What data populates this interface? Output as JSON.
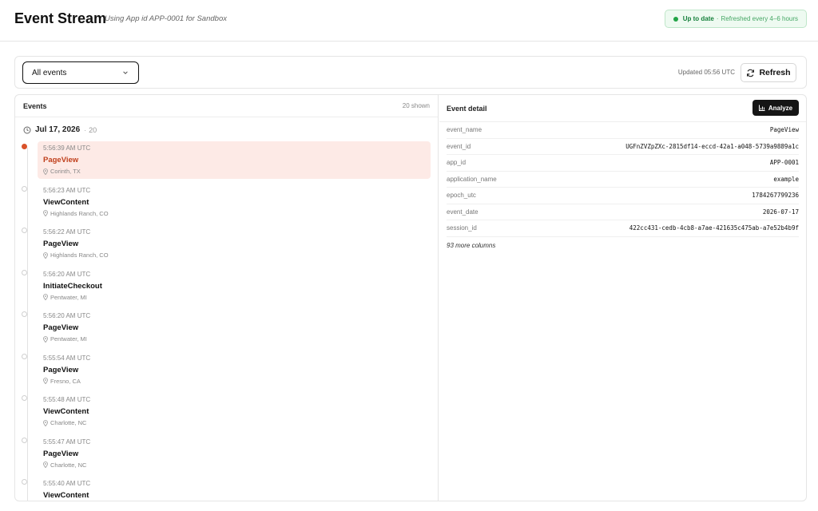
{
  "header": {
    "title": "Event Stream",
    "subtitle": "Using App id APP-0001 for Sandbox",
    "status": {
      "main": "Up to date",
      "separator": "·",
      "sub": "Refreshed every 4–6 hours",
      "color": "#22a447"
    }
  },
  "toolbar": {
    "filter_value": "All events",
    "updated_text": "Updated 05:56 UTC",
    "refresh_label": "Refresh"
  },
  "events_panel": {
    "title": "Events",
    "count_text": "20 shown",
    "date": "Jul 17, 2026",
    "date_separator": "·",
    "date_count": "20",
    "accent_color": "#d9522a",
    "items": [
      {
        "time": "5:56:39 AM UTC",
        "name": "PageView",
        "location": "Corinth, TX",
        "active": true
      },
      {
        "time": "5:56:23 AM UTC",
        "name": "ViewContent",
        "location": "Highlands Ranch, CO",
        "active": false
      },
      {
        "time": "5:56:22 AM UTC",
        "name": "PageView",
        "location": "Highlands Ranch, CO",
        "active": false
      },
      {
        "time": "5:56:20 AM UTC",
        "name": "InitiateCheckout",
        "location": "Pentwater, MI",
        "active": false
      },
      {
        "time": "5:56:20 AM UTC",
        "name": "PageView",
        "location": "Pentwater, MI",
        "active": false
      },
      {
        "time": "5:55:54 AM UTC",
        "name": "PageView",
        "location": "Fresno, CA",
        "active": false
      },
      {
        "time": "5:55:48 AM UTC",
        "name": "ViewContent",
        "location": "Charlotte, NC",
        "active": false
      },
      {
        "time": "5:55:47 AM UTC",
        "name": "PageView",
        "location": "Charlotte, NC",
        "active": false
      },
      {
        "time": "5:55:40 AM UTC",
        "name": "ViewContent",
        "location": "",
        "active": false
      }
    ]
  },
  "detail_panel": {
    "title": "Event detail",
    "analyze_label": "Analyze",
    "rows": [
      {
        "key": "event_name",
        "value": "PageView"
      },
      {
        "key": "event_id",
        "value": "UGFnZVZpZXc-2815df14-eccd-42a1-a048-5739a9889a1c"
      },
      {
        "key": "app_id",
        "value": "APP-0001"
      },
      {
        "key": "application_name",
        "value": "example"
      },
      {
        "key": "epoch_utc",
        "value": "1784267799236"
      },
      {
        "key": "event_date",
        "value": "2026-07-17"
      },
      {
        "key": "session_id",
        "value": "422cc431-cedb-4cb8-a7ae-421635c475ab-a7e52b4b9f"
      }
    ],
    "more_columns": "93 more columns"
  }
}
